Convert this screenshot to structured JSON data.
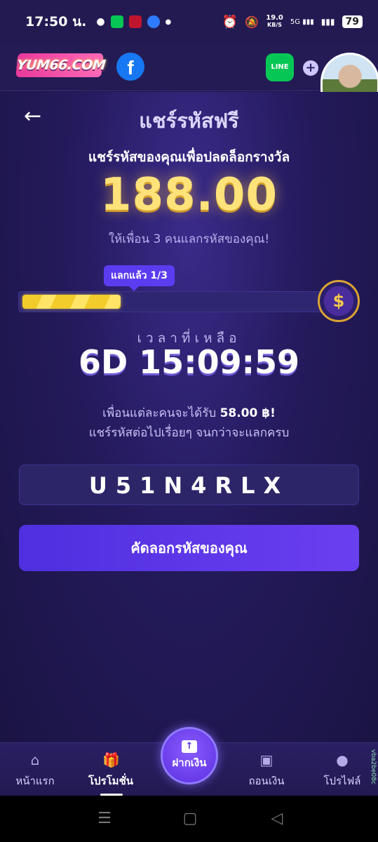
{
  "status_bar": {
    "time": "17:50 น.",
    "net_speed_value": "19.0",
    "net_speed_unit": "KB/S",
    "signal_label": "5G",
    "battery": "79"
  },
  "header": {
    "logo_text": "YUM66.COM",
    "facebook_glyph": "f",
    "line_label": "LINE",
    "plus_glyph": "+"
  },
  "page": {
    "back_glyph": "←",
    "title": "แชร์รหัสฟรี",
    "subtitle": "แชร์รหัสของคุณเพื่อปลดล็อกรางวัล",
    "amount": "188.00",
    "invite_text": "ให้เพื่อน 3 คนแลกรหัสของคุณ!",
    "progress_badge": "แลกแล้ว 1/3",
    "progress": {
      "current": 1,
      "total": 3
    },
    "reward_icon_glyph": "$",
    "time_label": "เวลาที่เหลือ",
    "countdown": "6D 15:09:59",
    "reward_line_prefix": "เพื่อนแต่ละคนจะได้รับ",
    "reward_line_amount": "58.00 ฿!",
    "continue_line": "แชร์รหัสต่อไปเรื่อยๆ จนกว่าจะแลกครบ",
    "code": "U51N4RLX",
    "copy_button": "คัดลอกรหัสของคุณ"
  },
  "bottom_nav": {
    "items": [
      {
        "label": "หน้าแรก",
        "icon": "home-icon"
      },
      {
        "label": "โปรโมชั่น",
        "icon": "gift-icon"
      },
      {
        "label": "ถอนเงิน",
        "icon": "wallet-icon"
      },
      {
        "label": "โปรไฟล์",
        "icon": "profile-icon"
      }
    ],
    "deposit_label": "ฝากเงิน",
    "side_tag": "vba2be08c"
  },
  "colors": {
    "background": "#1a1440",
    "accent": "#5b3cf0",
    "amount_gold": "#ffe27a",
    "progress_fill": "#f1cc2a"
  }
}
